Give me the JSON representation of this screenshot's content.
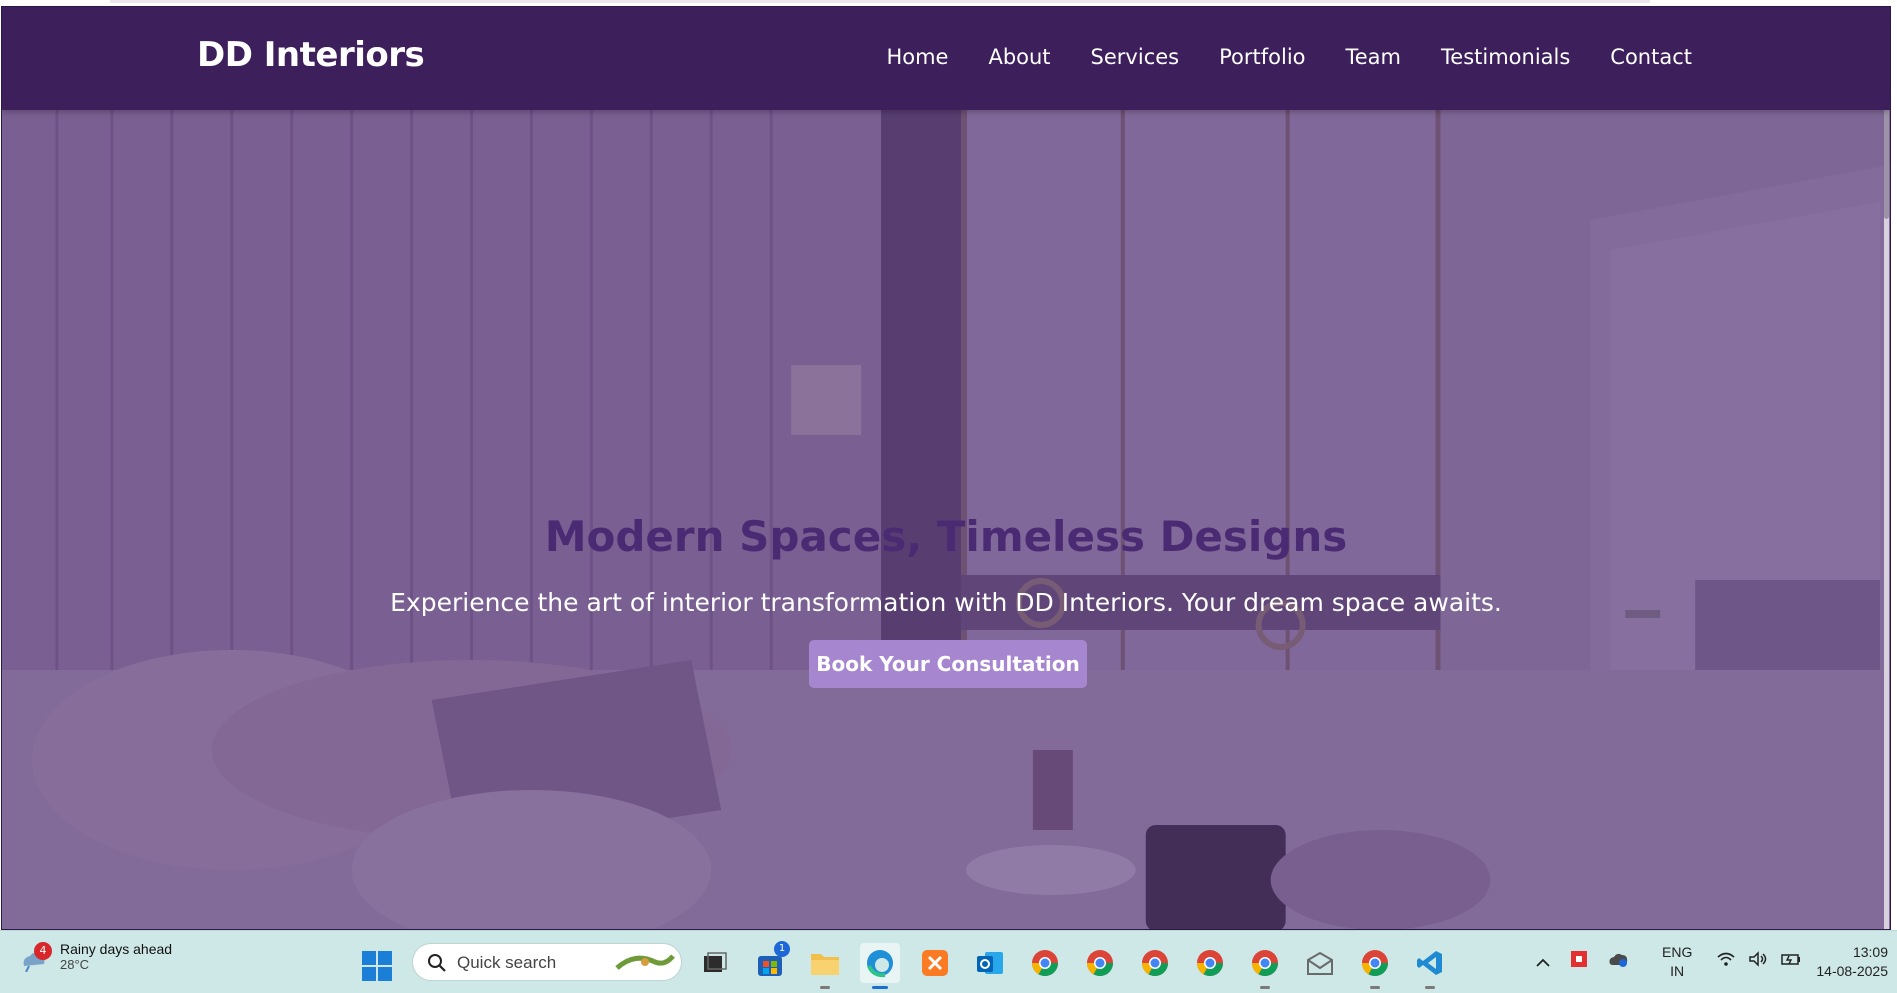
{
  "site": {
    "logo": "DD Interiors",
    "nav": [
      "Home",
      "About",
      "Services",
      "Portfolio",
      "Team",
      "Testimonials",
      "Contact"
    ]
  },
  "hero": {
    "title": "Modern Spaces, Timeless Designs",
    "subtitle": "Experience the art of interior transformation with DD Interiors. Your dream space awaits.",
    "cta_label": "Book Your Consultation"
  },
  "colors": {
    "navbar": "#3d1f5c",
    "hero_title": "#4a2a72",
    "cta": "#a687cf",
    "taskbar": "#cde8e6"
  },
  "taskbar": {
    "weather": {
      "badge": "4",
      "title": "Rainy days ahead",
      "temp": "28°C",
      "icon": "rain-cloud-icon"
    },
    "search_placeholder": "Quick search",
    "apps": [
      {
        "name": "task-view",
        "icon": "task-view-icon"
      },
      {
        "name": "microsoft-store",
        "icon": "store-icon",
        "badge": "1"
      },
      {
        "name": "file-explorer",
        "icon": "folder-icon"
      },
      {
        "name": "edge",
        "icon": "edge-icon",
        "active": true
      },
      {
        "name": "xampp",
        "icon": "xampp-icon"
      },
      {
        "name": "outlook",
        "icon": "outlook-icon"
      },
      {
        "name": "chrome-1",
        "icon": "chrome-icon"
      },
      {
        "name": "chrome-2",
        "icon": "chrome-icon"
      },
      {
        "name": "chrome-3",
        "icon": "chrome-icon"
      },
      {
        "name": "chrome-4",
        "icon": "chrome-icon"
      },
      {
        "name": "chrome-5",
        "icon": "chrome-icon"
      },
      {
        "name": "mail",
        "icon": "mail-icon"
      },
      {
        "name": "chrome-6",
        "icon": "chrome-icon"
      },
      {
        "name": "vscode",
        "icon": "vscode-icon"
      }
    ],
    "language": {
      "line1": "ENG",
      "line2": "IN"
    },
    "time": "13:09",
    "date": "14-08-2025"
  }
}
